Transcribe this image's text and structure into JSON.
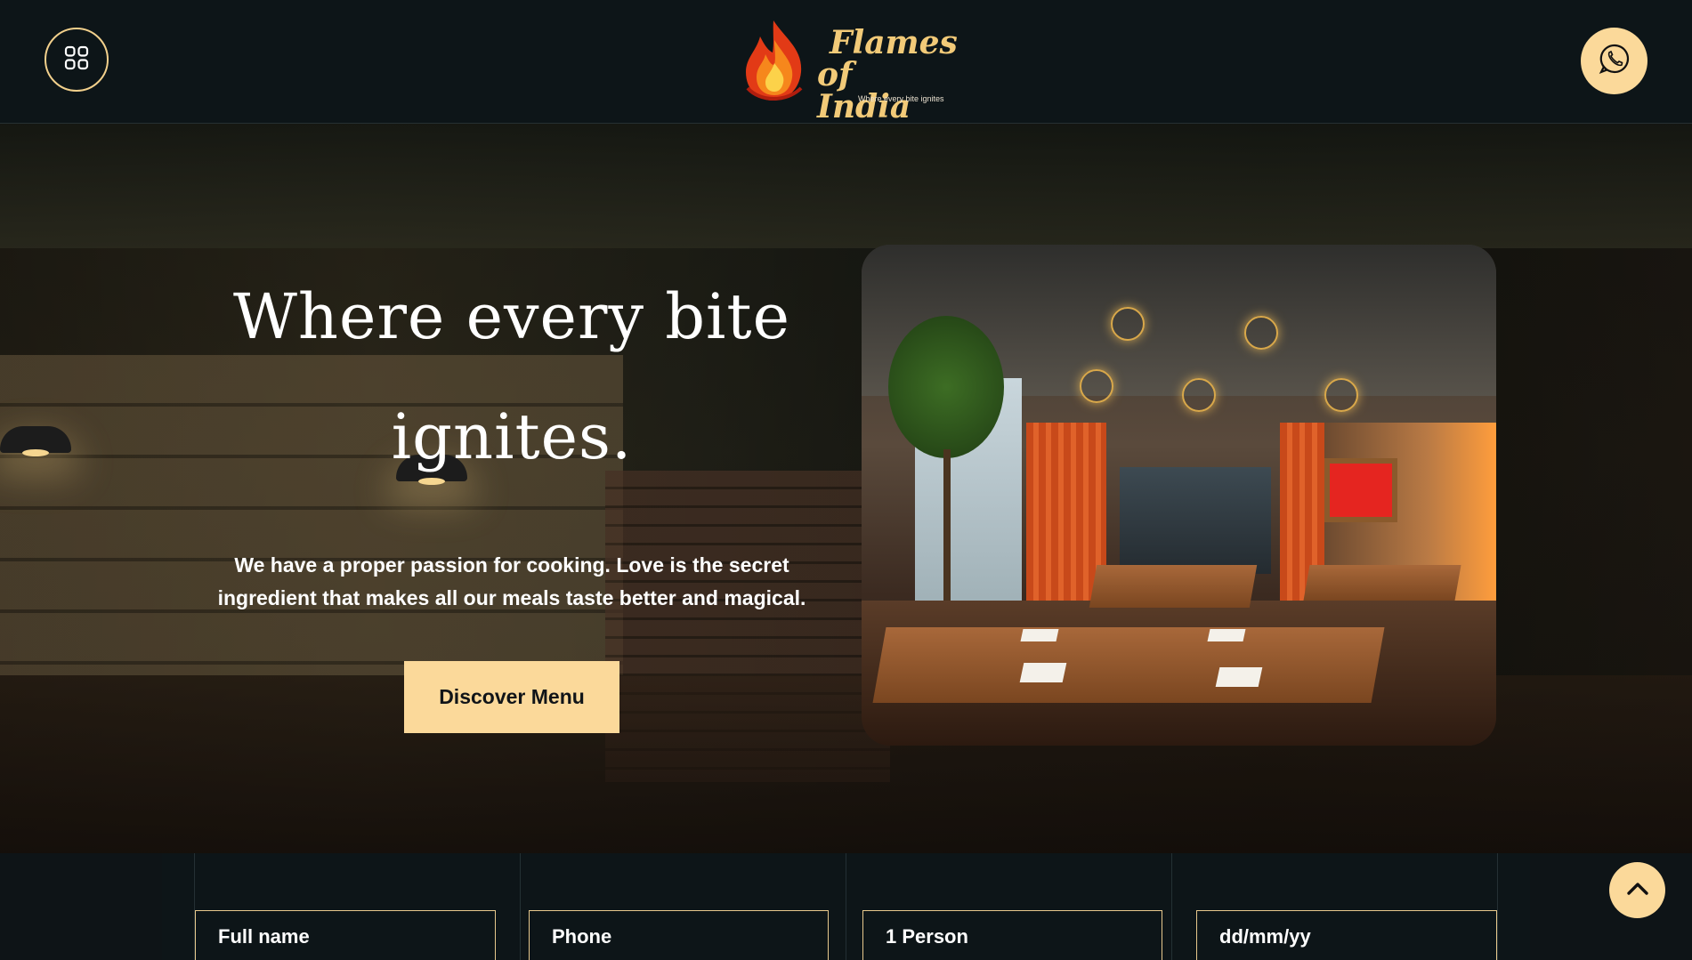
{
  "header": {
    "menu_icon": "grid-icon",
    "logo": {
      "line1": "Flames",
      "line2": "of India",
      "tagline": "Where every bite ignites"
    },
    "whatsapp_icon": "whatsapp-icon"
  },
  "hero": {
    "title": "Where every bite ignites.",
    "description": "We have a proper passion for cooking. Love is the secret ingredient that makes all our meals taste better and magical.",
    "cta_label": "Discover Menu"
  },
  "reservation": {
    "name_placeholder": "Full name",
    "phone_placeholder": "Phone",
    "guests_value": "1 Person",
    "date_placeholder": "dd/mm/yy"
  },
  "scroll_top_icon": "chevron-up-icon",
  "colors": {
    "accent": "#fbd99a",
    "background": "#0d1518",
    "gold": "#f2ca78"
  }
}
